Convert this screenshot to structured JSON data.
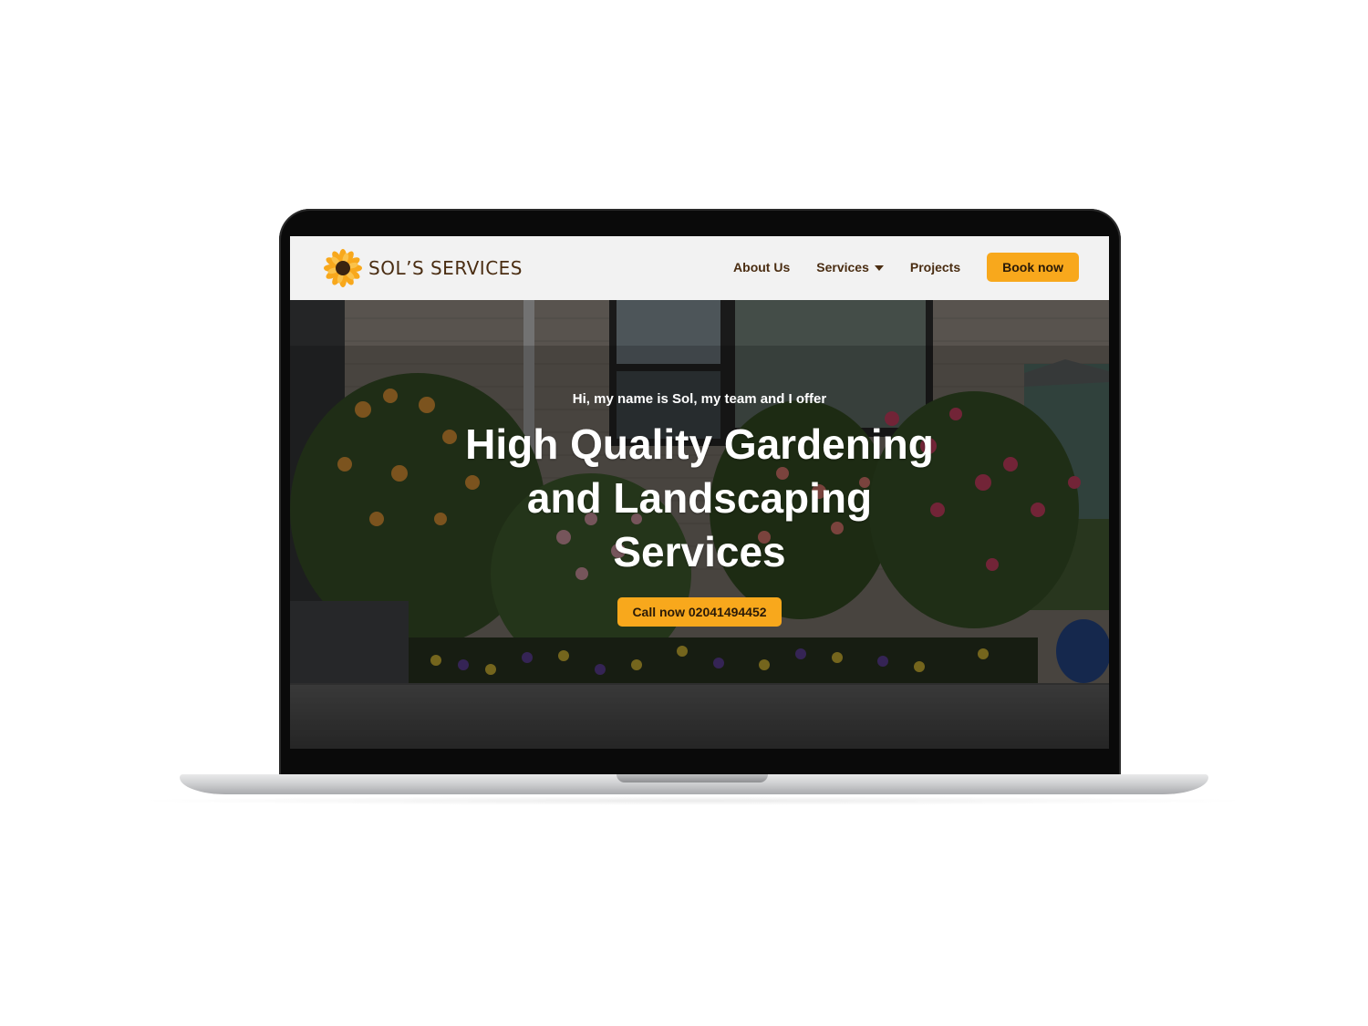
{
  "brand": {
    "name": "SOL’S SERVICES",
    "logo_icon": "sunflower-icon"
  },
  "nav": {
    "about": "About Us",
    "services": "Services",
    "projects": "Projects",
    "book": "Book now"
  },
  "hero": {
    "intro": "Hi, my name is Sol, my team and I offer",
    "title": "High Quality Gardening and Landscaping Services",
    "cta": "Call now 02041494452"
  },
  "colors": {
    "accent": "#f8a81c",
    "brand_text": "#4a2d12",
    "nav_bg": "#f2f2f2"
  }
}
